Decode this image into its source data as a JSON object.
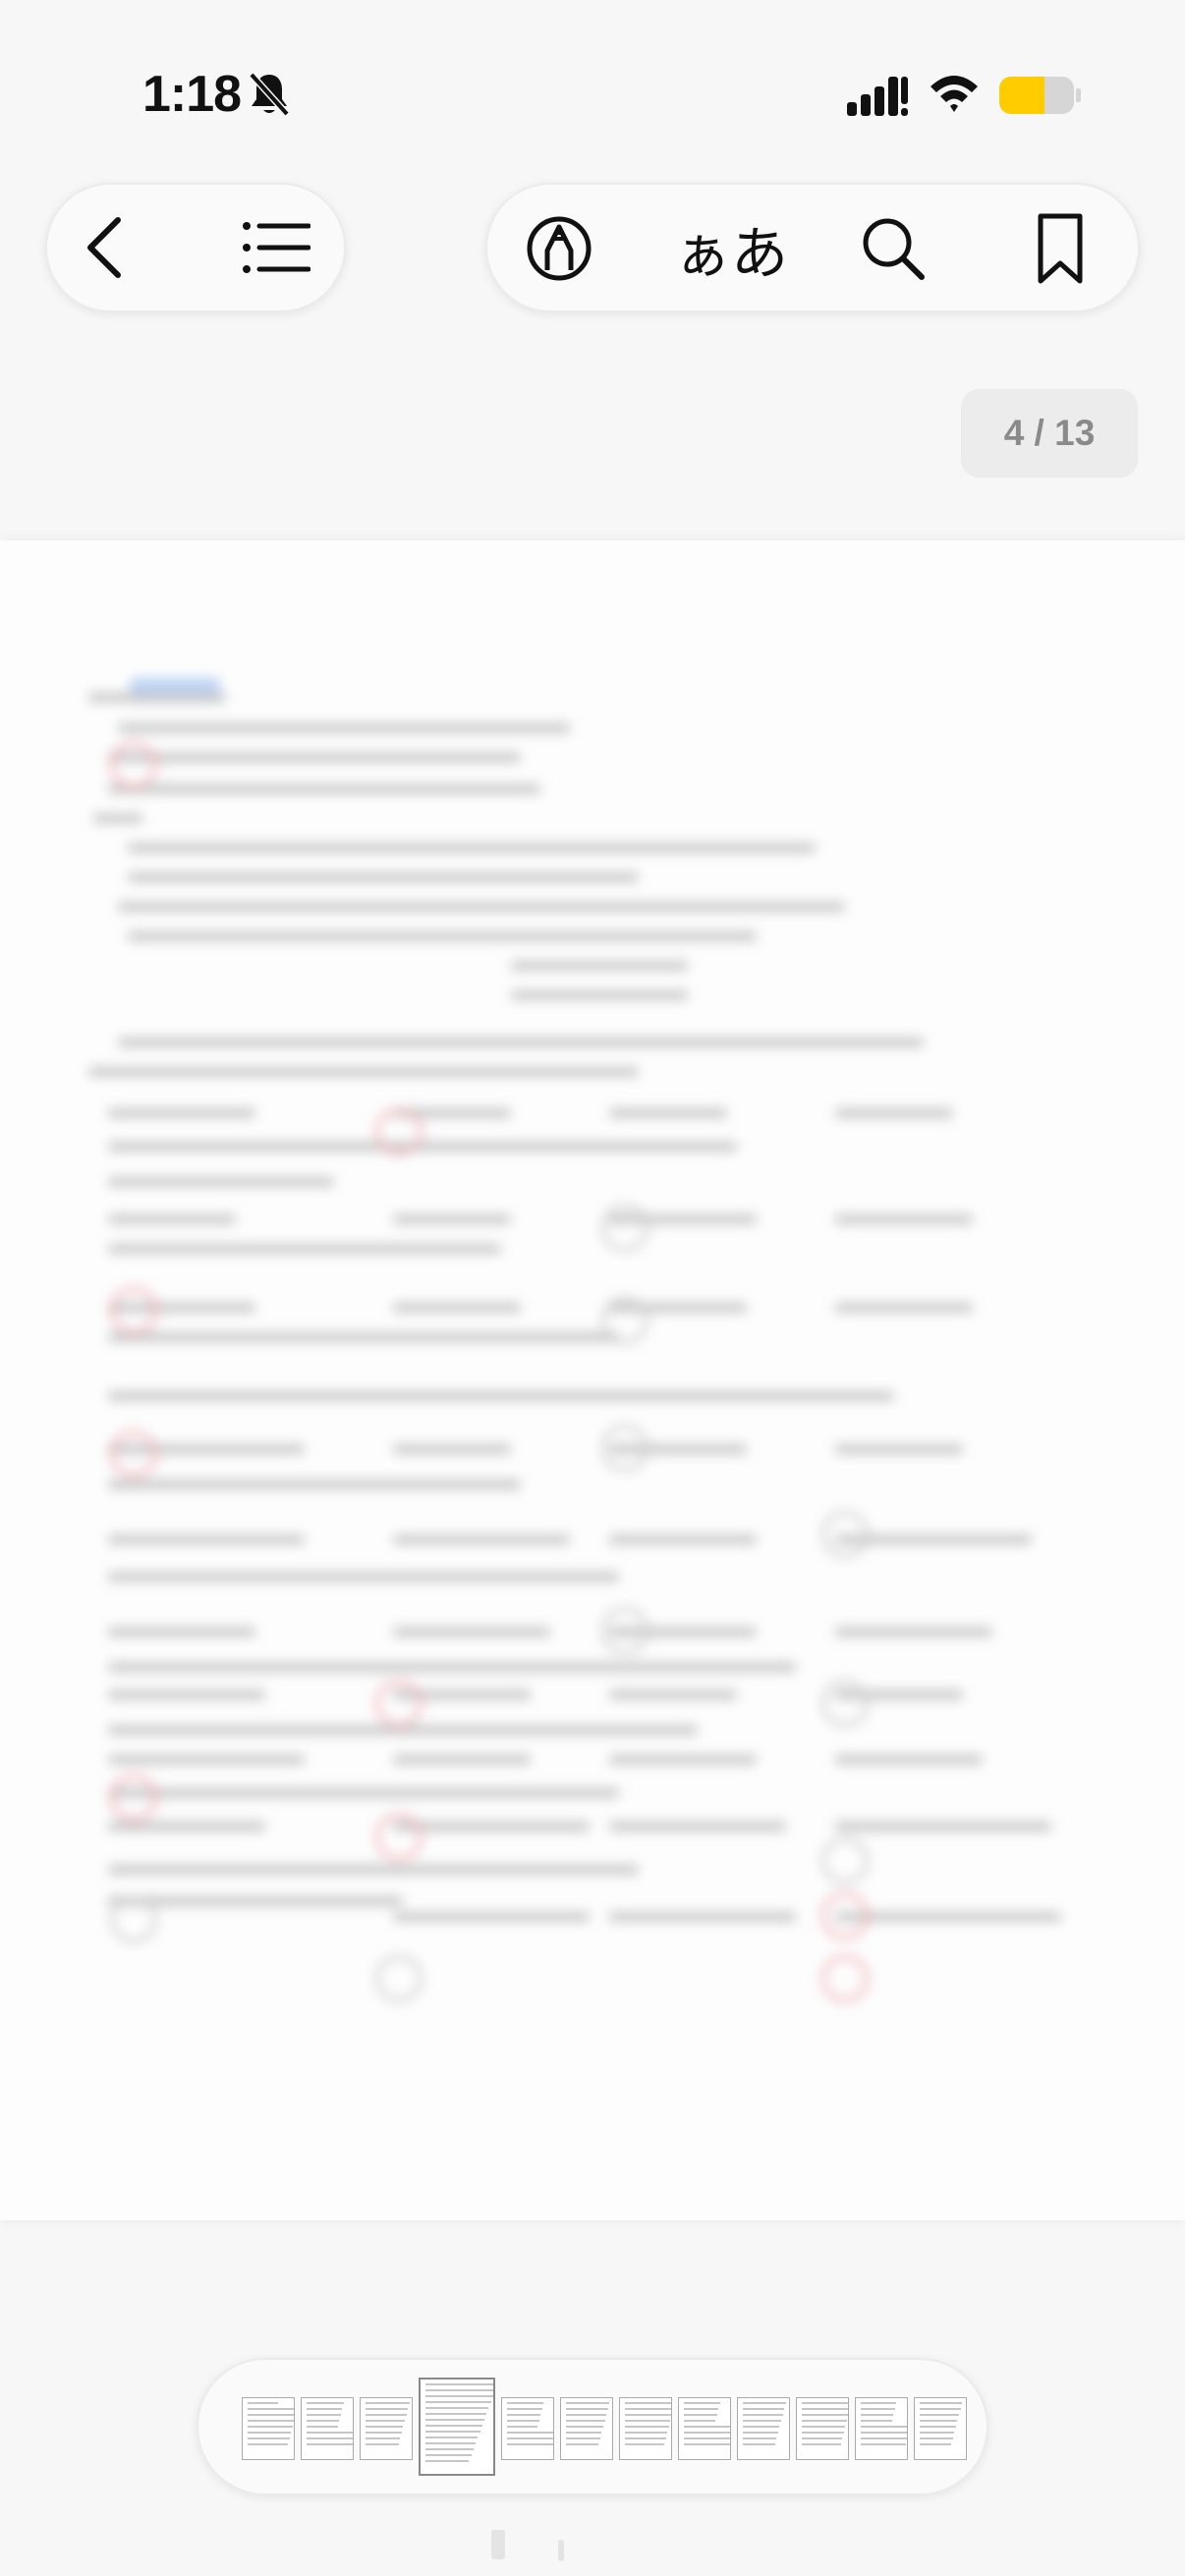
{
  "status_bar": {
    "time": "1:18",
    "battery_color": "#ffcc00"
  },
  "toolbar": {
    "back_icon": "chevron-left-icon",
    "toc_icon": "list-icon",
    "markup_icon": "pencil-circle-icon",
    "font_label": "ぁあ",
    "search_icon": "search-icon",
    "bookmark_icon": "bookmark-icon"
  },
  "page_indicator": {
    "current": 4,
    "total": 13,
    "text": "4 / 13"
  },
  "thumbnails": {
    "count": 12,
    "active_index": 3
  },
  "colors": {
    "background": "#f7f7f7",
    "page": "#fdfdfd",
    "counter_bg": "#ececec",
    "counter_text": "#8a8a8a"
  }
}
